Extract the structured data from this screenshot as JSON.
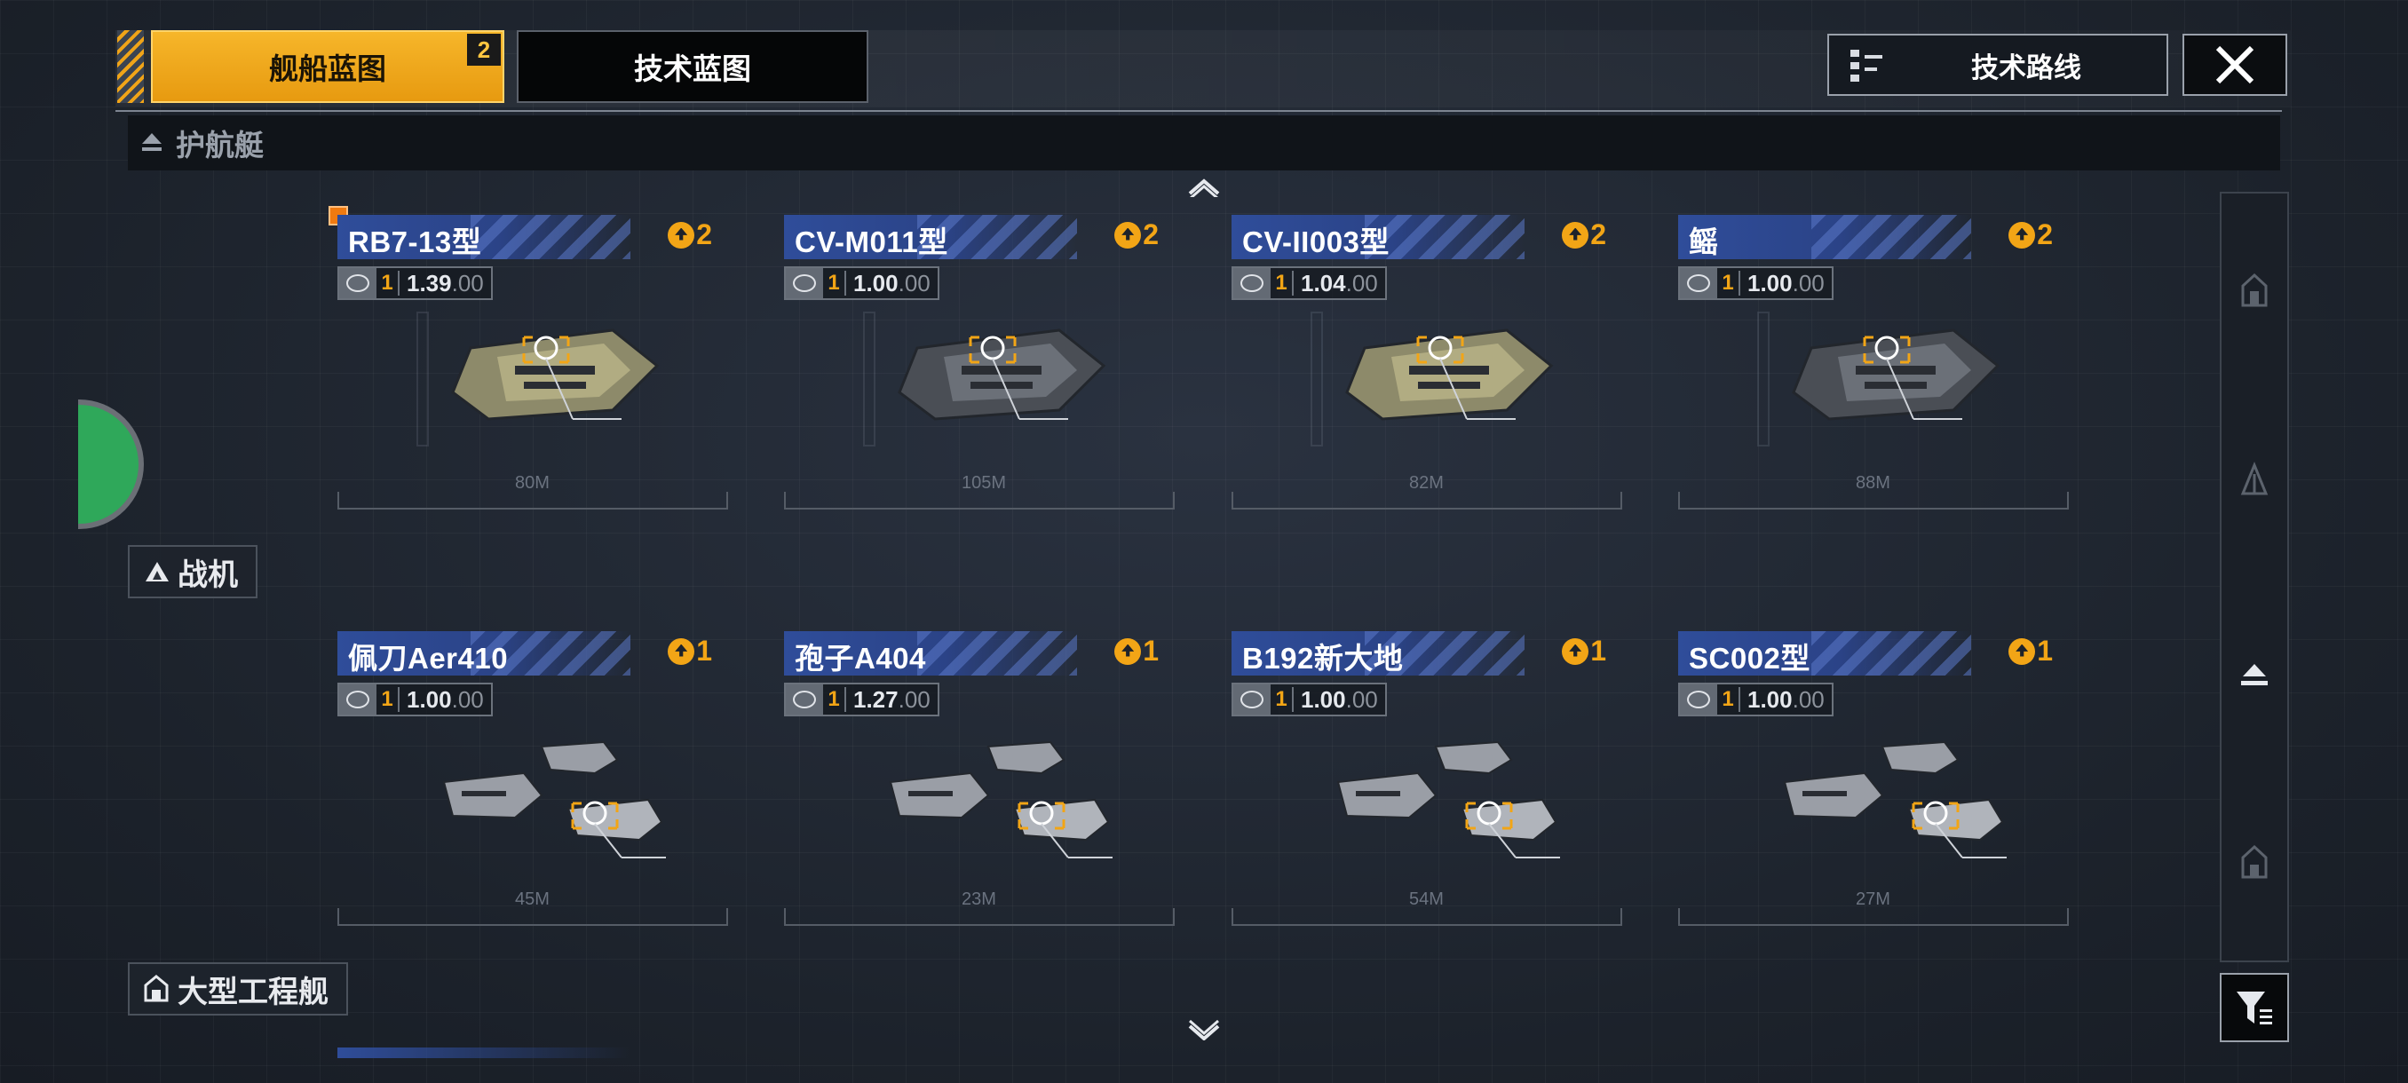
{
  "tabs": {
    "ship_blueprints": "舰船蓝图",
    "ship_blueprints_badge": "2",
    "tech_blueprints": "技术蓝图"
  },
  "header": {
    "tech_route": "技术路线"
  },
  "sections": {
    "escort": "护航艇",
    "fighter": "战机",
    "engineering": "大型工程舰"
  },
  "cards": [
    {
      "name": "RB7-13型",
      "level": "2",
      "cost": "1",
      "multiplier": "1.39",
      "mult_suffix": ".00",
      "length": "80M",
      "icon": "fighter-class-icon"
    },
    {
      "name": "CV-M011型",
      "level": "2",
      "cost": "1",
      "multiplier": "1.00",
      "mult_suffix": ".00",
      "length": "105M",
      "icon": "globe-icon"
    },
    {
      "name": "CV-II003型",
      "level": "2",
      "cost": "1",
      "multiplier": "1.04",
      "mult_suffix": ".00",
      "length": "82M",
      "icon": "globe-icon"
    },
    {
      "name": "鳐",
      "level": "2",
      "cost": "1",
      "multiplier": "1.00",
      "mult_suffix": ".00",
      "length": "88M",
      "icon": "fighter-class-icon"
    },
    {
      "name": "佩刀Aer410",
      "level": "1",
      "cost": "1",
      "multiplier": "1.00",
      "mult_suffix": ".00",
      "length": "45M",
      "icon": "faction-icon"
    },
    {
      "name": "孢子A404",
      "level": "1",
      "cost": "1",
      "multiplier": "1.27",
      "mult_suffix": ".00",
      "length": "23M",
      "icon": "faction-icon"
    },
    {
      "name": "B192新大地",
      "level": "1",
      "cost": "1",
      "multiplier": "1.00",
      "mult_suffix": ".00",
      "length": "54M",
      "icon": "globe-icon"
    },
    {
      "name": "SC002型",
      "level": "1",
      "cost": "1",
      "multiplier": "1.00",
      "mult_suffix": ".00",
      "length": "27M",
      "icon": "globe-icon"
    }
  ],
  "colors": {
    "accent": "#f2a516",
    "card_header": "#2f4d9a",
    "background": "#1f2630"
  }
}
